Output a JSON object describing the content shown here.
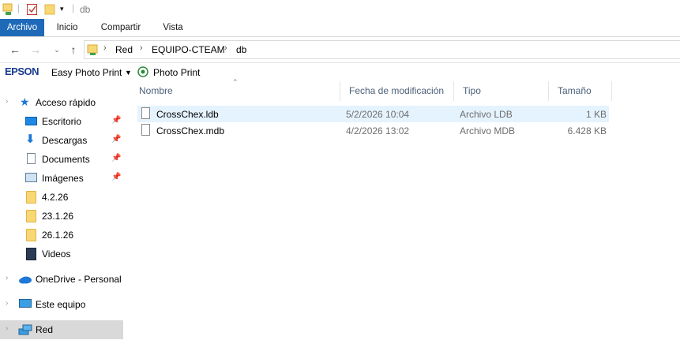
{
  "title": "db",
  "ribbon": {
    "tabs": [
      "Archivo",
      "Inicio",
      "Compartir",
      "Vista"
    ]
  },
  "breadcrumb": [
    "Red",
    "EQUIPO-CTEAM",
    "db"
  ],
  "epson": {
    "logo": "EPSON",
    "easy_photo_print": "Easy Photo Print",
    "photo_print": "Photo Print"
  },
  "nav": {
    "quick_access": "Acceso rápido",
    "pinned": [
      {
        "label": "Escritorio",
        "icon": "desktop-icon"
      },
      {
        "label": "Descargas",
        "icon": "download-icon"
      },
      {
        "label": "Documents",
        "icon": "document-icon"
      },
      {
        "label": "Imágenes",
        "icon": "image-icon"
      }
    ],
    "folders": [
      {
        "label": "4.2.26",
        "icon": "folder-icon"
      },
      {
        "label": "23.1.26",
        "icon": "folder-icon"
      },
      {
        "label": "26.1.26",
        "icon": "folder-icon"
      },
      {
        "label": "Videos",
        "icon": "video-icon"
      }
    ],
    "onedrive": "OneDrive - Personal",
    "this_pc": "Este equipo",
    "network": "Red"
  },
  "columns": [
    "Nombre",
    "Fecha de modificación",
    "Tipo",
    "Tamaño"
  ],
  "files": [
    {
      "name": "CrossChex.ldb",
      "date": "5/2/2026 10:04",
      "type": "Archivo LDB",
      "size": "1 KB",
      "selected": true
    },
    {
      "name": "CrossChex.mdb",
      "date": "4/2/2026 13:02",
      "type": "Archivo MDB",
      "size": "6.428 KB",
      "selected": false
    }
  ],
  "colors": {
    "accent": "#1e6ab8",
    "selection": "#e5f3ff",
    "nav_selected": "#d9d9d9"
  }
}
